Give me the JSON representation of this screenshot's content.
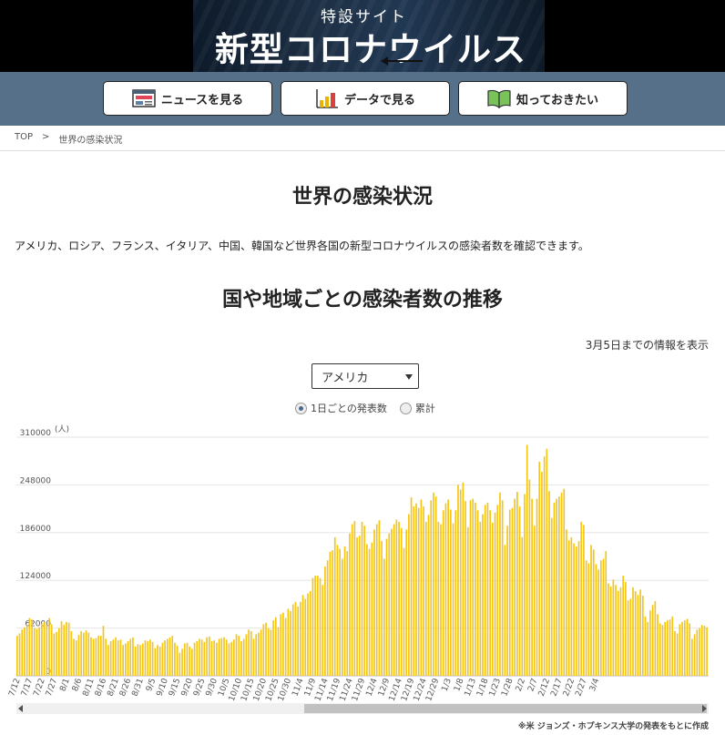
{
  "banner": {
    "subtitle": "特設サイト",
    "title": "新型コロナウイルス"
  },
  "nav": {
    "news_label": "ニュースを見る",
    "data_label": "データで見る",
    "know_label": "知っておきたい"
  },
  "breadcrumb": {
    "home": "TOP",
    "separator": ">",
    "current": "世界の感染状況"
  },
  "page": {
    "title": "世界の感染状況",
    "intro": "アメリカ、ロシア、フランス、イタリア、中国、韓国など世界各国の新型コロナウイルスの感染者数を確認できます。",
    "section_title": "国や地域ごとの感染者数の推移",
    "date_note": "3月5日までの情報を表示"
  },
  "country_select": {
    "value": "アメリカ"
  },
  "mode_toggle": {
    "daily_label": "1日ごとの発表数",
    "cumulative_label": "累計",
    "selected": "daily"
  },
  "source_note": "※米 ジョンズ・ホプキンス大学の発表をもとに作成",
  "colors": {
    "bar": "#f5c518",
    "nav_bg": "#577089",
    "accent": "#4a6a8a"
  },
  "chart_data": {
    "type": "bar",
    "ylabel": "(人)",
    "yticks": [
      0,
      62000,
      124000,
      186000,
      248000,
      310000
    ],
    "ylim": [
      0,
      310000
    ],
    "grid": true,
    "xtick_labels": [
      "7/12",
      "7/17",
      "7/22",
      "7/27",
      "8/1",
      "8/6",
      "8/11",
      "8/16",
      "8/21",
      "8/26",
      "8/31",
      "9/5",
      "9/10",
      "9/15",
      "9/20",
      "9/25",
      "9/30",
      "10/5",
      "10/10",
      "10/15",
      "10/20",
      "10/25",
      "10/30",
      "11/4",
      "11/9",
      "11/14",
      "11/19",
      "11/24",
      "11/29",
      "12/4",
      "12/9",
      "12/14",
      "12/19",
      "12/24",
      "12/29",
      "1/3",
      "1/8",
      "1/13",
      "1/18",
      "1/23",
      "1/28",
      "2/2",
      "2/7",
      "2/12",
      "2/17",
      "2/22",
      "2/27",
      "3/4"
    ],
    "start_date": "7/12",
    "series": [
      {
        "values": [
          52000,
          55000,
          60000,
          63000,
          65000,
          75000,
          73000,
          62000,
          61000,
          63000,
          68000,
          70000,
          66000,
          75000,
          67000,
          55000,
          57000,
          62000,
          71000,
          66000,
          70000,
          69000,
          58000,
          48000,
          46000,
          53000,
          58000,
          56000,
          59000,
          56000,
          50000,
          48000,
          49000,
          52000,
          52000,
          65000,
          48000,
          40000,
          45000,
          47000,
          50000,
          46000,
          47000,
          40000,
          42000,
          45000,
          48000,
          50000,
          38000,
          41000,
          40000,
          42000,
          46000,
          45000,
          47000,
          44000,
          36000,
          40000,
          38000,
          43000,
          46000,
          48000,
          50000,
          52000,
          43000,
          39000,
          30000,
          35000,
          42000,
          43000,
          38000,
          35000,
          43000,
          45000,
          48000,
          47000,
          44000,
          50000,
          51000,
          45000,
          46000,
          43000,
          48000,
          49000,
          50000,
          47000,
          42000,
          44000,
          47000,
          54000,
          52000,
          45000,
          48000,
          54000,
          60000,
          58000,
          48000,
          54000,
          56000,
          60000,
          67000,
          69000,
          62000,
          60000,
          72000,
          76000,
          63000,
          80000,
          82000,
          75000,
          87000,
          84000,
          93000,
          96000,
          90000,
          96000,
          105000,
          100000,
          107000,
          110000,
          127000,
          130000,
          130000,
          127000,
          118000,
          142000,
          150000,
          161000,
          163000,
          180000,
          170000,
          165000,
          152000,
          168000,
          162000,
          185000,
          197000,
          201000,
          180000,
          182000,
          200000,
          195000,
          171000,
          165000,
          173000,
          190000,
          197000,
          202000,
          175000,
          152000,
          178000,
          185000,
          191000,
          197000,
          203000,
          200000,
          192000,
          166000,
          190000,
          210000,
          232000,
          220000,
          224000,
          218000,
          229000,
          220000,
          200000,
          209000,
          228000,
          238000,
          233000,
          200000,
          197000,
          215000,
          224000,
          229000,
          216000,
          198000,
          215000,
          248000,
          242000,
          251000,
          227000,
          193000,
          228000,
          230000,
          225000,
          215000,
          200000,
          210000,
          222000,
          225000,
          215000,
          199000,
          212000,
          222000,
          238000,
          228000,
          170000,
          195000,
          216000,
          218000,
          230000,
          239000,
          220000,
          180000,
          236000,
          300000,
          255000,
          230000,
          195000,
          230000,
          278000,
          265000,
          285000,
          295000,
          240000,
          205000,
          225000,
          230000,
          233000,
          238000,
          243000,
          190000,
          176000,
          180000,
          172000,
          168000,
          175000,
          200000,
          196000,
          150000,
          146000,
          170000,
          164000,
          145000,
          138000,
          150000,
          152000,
          162000,
          120000,
          116000,
          125000,
          118000,
          110000,
          115000,
          130000,
          122000,
          98000,
          100000,
          115000,
          110000,
          105000,
          112000,
          104000,
          77000,
          70000,
          85000,
          92000,
          97000,
          80000,
          68000,
          66000,
          70000,
          72000,
          73000,
          77000,
          58000,
          55000,
          67000,
          70000,
          72000,
          74000,
          68000,
          48000,
          54000,
          60000,
          62000,
          66000,
          65000,
          63000
        ]
      }
    ]
  }
}
